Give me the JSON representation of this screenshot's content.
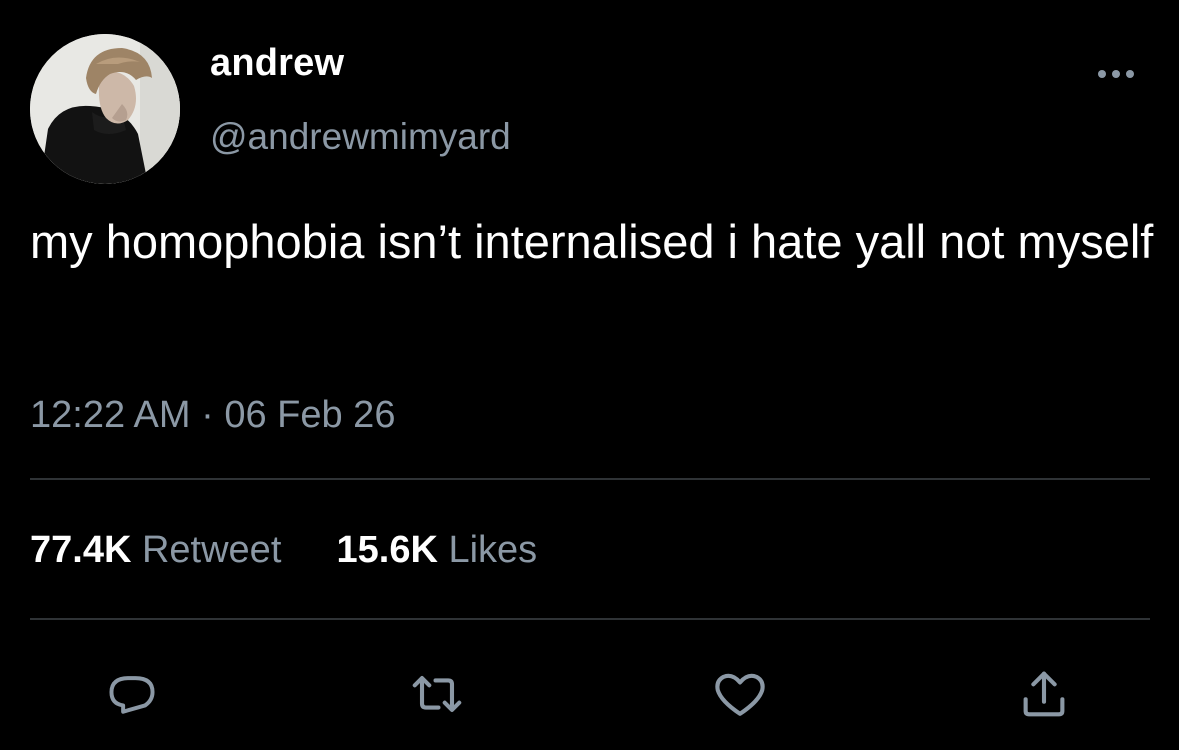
{
  "user": {
    "display_name": "andrew",
    "handle": "@andrewmimyard"
  },
  "tweet": {
    "text": "my homophobia isn’t internalised i hate yall not myself",
    "timestamp": "12:22 AM · 06 Feb 26"
  },
  "stats": {
    "retweets_count": "77.4K",
    "retweets_label": "Retweet",
    "likes_count": "15.6K",
    "likes_label": "Likes"
  },
  "icons": {
    "more": "more-horizontal-icon",
    "reply": "reply-icon",
    "retweet": "retweet-icon",
    "like": "heart-icon",
    "share": "share-icon"
  },
  "colors": {
    "background": "#000000",
    "text": "#ffffff",
    "secondary": "#8b98a5",
    "divider": "#2f3336"
  }
}
